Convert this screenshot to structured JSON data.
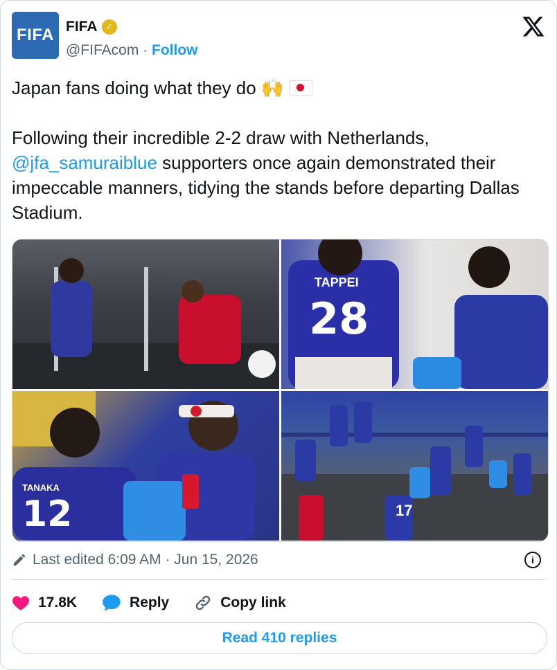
{
  "account": {
    "avatar_text": "FIFA",
    "name": "FIFA",
    "handle": "@FIFAcom",
    "separator": "·",
    "follow_label": "Follow"
  },
  "tweet": {
    "line1": "Japan fans doing what they do",
    "body_before_mention": "Following their incredible 2-2 draw with Netherlands,",
    "mention": "@jfa_samuraiblue",
    "body_after_mention": " supporters once again demonstrated their impeccable manners, tidying the stands before departing Dallas Stadium."
  },
  "media": {
    "photo1_shirt_text": "",
    "photo2_jersey_name": "TAPPEI",
    "photo2_jersey_number": "28",
    "photo3_jersey_name": "TANAKA",
    "photo3_jersey_number": "12",
    "photo4_jersey_number": "17"
  },
  "meta": {
    "edited_text": "Last edited 6:09 AM · Jun 15, 2026"
  },
  "actions": {
    "like_count": "17.8K",
    "reply_label": "Reply",
    "copy_label": "Copy link"
  },
  "read_replies_label": "Read 410 replies",
  "colors": {
    "accent": "#1d9bf0",
    "like": "#f91880",
    "verified": "#e2b719",
    "avatar_bg": "#2c6bb3"
  },
  "icons": {
    "verified": "verified-badge-icon",
    "x_logo": "x-logo-icon",
    "edit": "pencil-icon",
    "info": "info-icon",
    "like": "heart-icon",
    "reply": "chat-bubble-icon",
    "copy": "link-icon"
  }
}
